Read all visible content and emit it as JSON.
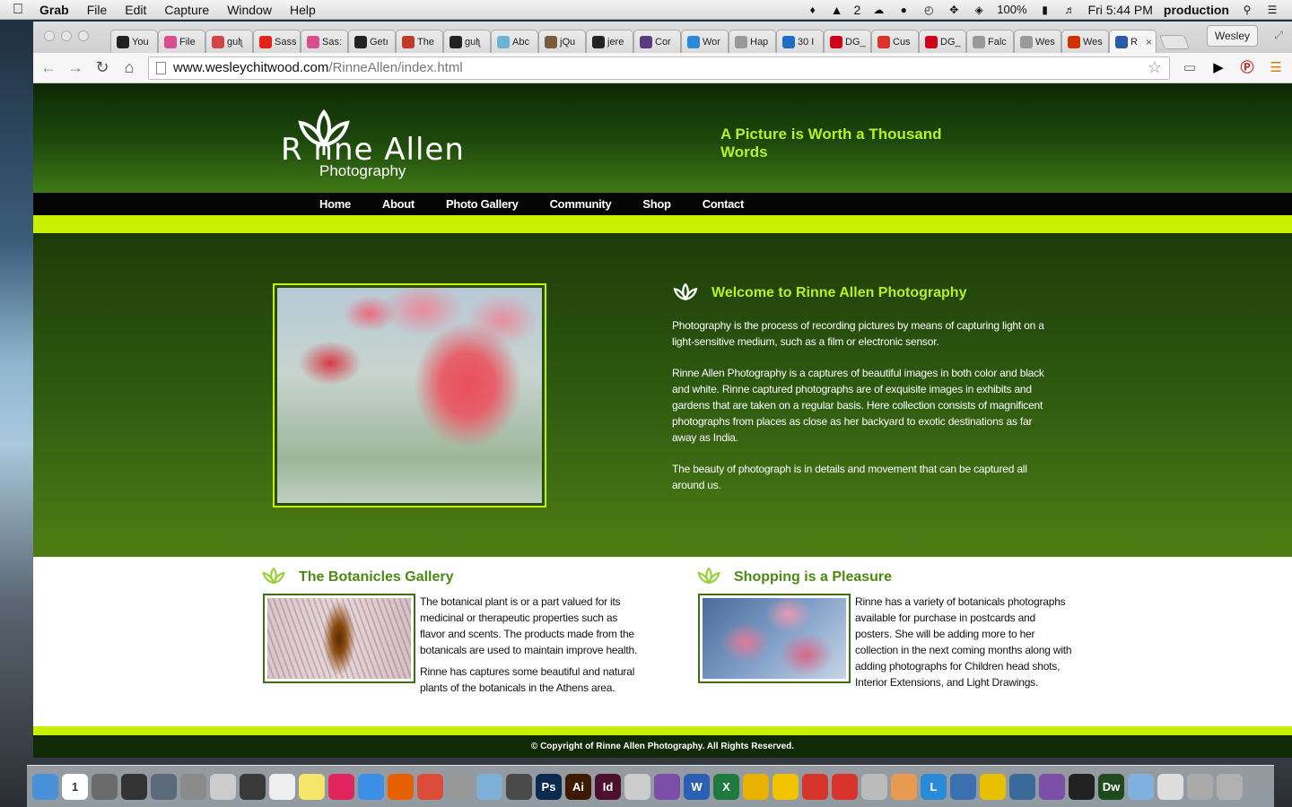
{
  "menubar": {
    "app": "Grab",
    "items": [
      "File",
      "Edit",
      "Capture",
      "Window",
      "Help"
    ],
    "status": {
      "notifications": "2",
      "battery": "100%",
      "clock": "Fri 5:44 PM",
      "user": "production"
    }
  },
  "browser": {
    "tabs": [
      {
        "label": "You",
        "color": "#222222",
        "icon": "github-icon"
      },
      {
        "label": "File",
        "color": "#d94f8c",
        "icon": "sass-icon"
      },
      {
        "label": "gulʅ",
        "color": "#cf4646",
        "icon": "gulp-icon"
      },
      {
        "label": "Sass",
        "color": "#e62117",
        "icon": "youtube-icon"
      },
      {
        "label": "Sas:",
        "color": "#d94f8c",
        "icon": "sass-icon"
      },
      {
        "label": "Getı",
        "color": "#222222",
        "icon": "circle-icon"
      },
      {
        "label": "The",
        "color": "#c0392b",
        "icon": "zo-icon"
      },
      {
        "label": "gulʅ",
        "color": "#222222",
        "icon": "github-icon"
      },
      {
        "label": "Abc",
        "color": "#6fb3d2",
        "icon": "code-icon"
      },
      {
        "label": "jQu",
        "color": "#7a5c3c",
        "icon": "avatar-icon"
      },
      {
        "label": "jere",
        "color": "#222222",
        "icon": "github-icon"
      },
      {
        "label": "Cor",
        "color": "#563d7c",
        "icon": "bootstrap-icon"
      },
      {
        "label": "Wor",
        "color": "#2b8ad8",
        "icon": "t-icon"
      },
      {
        "label": "Hap",
        "color": "#999999",
        "icon": "page-icon"
      },
      {
        "label": "30 I",
        "color": "#1e6fc2",
        "icon": "h-icon"
      },
      {
        "label": "DG_",
        "color": "#d0021b",
        "icon": "pr-icon"
      },
      {
        "label": "Cus",
        "color": "#d9342b",
        "icon": "s-icon"
      },
      {
        "label": "DG_",
        "color": "#d0021b",
        "icon": "pr-icon"
      },
      {
        "label": "Falc",
        "color": "#999999",
        "icon": "page-icon"
      },
      {
        "label": "Wes",
        "color": "#999999",
        "icon": "page-icon"
      },
      {
        "label": "Wes",
        "color": "#cc3300",
        "icon": "w-icon"
      },
      {
        "label": "R",
        "color": "#2b5ba8",
        "icon": "grid-icon"
      }
    ],
    "profile": "Wesley",
    "url_host": "www.wesleychitwood.com",
    "url_path": "/RinneAllen/index.html"
  },
  "site": {
    "logo": {
      "name": "R   nne Allen",
      "sub": "Photography"
    },
    "tagline": "A Picture is Worth a Thousand Words",
    "nav": [
      "Home",
      "About",
      "Photo Gallery",
      "Community",
      "Shop",
      "Contact"
    ],
    "welcome": {
      "title": "Welcome to Rinne Allen Photography",
      "p1": "Photography is the process of recording pictures by means of capturing light on a light-sensitive medium, such as a film or electronic sensor.",
      "p2": "Rinne Allen Photography is a captures of beautiful images in both color and black and white. Rinne captured photographs are of exquisite images in exhibits and gardens that are taken on a regular basis. Here collection consists of magnificent photographs from places as close as her backyard to exotic destinations as far away as India.",
      "p3": "The beauty of photograph is in details and movement that can be captured all around us."
    },
    "gallery": {
      "title": "The Botanicles Gallery",
      "p1": "The botanical plant is or a part valued for its medicinal or therapeutic properties such as flavor and scents. The products made from the botanicals are used to maintain improve health.",
      "p2": "Rinne has captures some beautiful and natural plants of the botanicals in the Athens area."
    },
    "shopping": {
      "title": "Shopping is a Pleasure",
      "p1": "Rinne has a variety of botanicals photographs available for purchase in postcards and posters. She will be adding more to her collection in the next coming months along with adding photographs for Children head shots, Interior Extensions, and Light Drawings."
    },
    "footer": "© Copyright of Rinne Allen Photography. All Rights Reserved.",
    "colors": {
      "accent": "#c8f000",
      "heading": "#b8f026",
      "dark_green": "#1e3d09"
    }
  },
  "dock": [
    {
      "name": "finder",
      "color": "#4a90d9"
    },
    {
      "name": "calendar",
      "color": "#ffffff",
      "text": "1"
    },
    {
      "name": "launchpad",
      "color": "#6b6b6b"
    },
    {
      "name": "dashboard",
      "color": "#333333"
    },
    {
      "name": "mission-control",
      "color": "#5a6a7a"
    },
    {
      "name": "system-preferences",
      "color": "#8a8a8a"
    },
    {
      "name": "calculator",
      "color": "#cccccc"
    },
    {
      "name": "facetime",
      "color": "#3a3a3a"
    },
    {
      "name": "textedit",
      "color": "#eeeeee"
    },
    {
      "name": "stickies",
      "color": "#f5e56b"
    },
    {
      "name": "itunes",
      "color": "#e0245e"
    },
    {
      "name": "safari",
      "color": "#3d8ee6"
    },
    {
      "name": "firefox",
      "color": "#e66000"
    },
    {
      "name": "chrome",
      "color": "#dd4b39"
    },
    {
      "name": "preview",
      "color": "#999999"
    },
    {
      "name": "photo-app",
      "color": "#7fb0d8"
    },
    {
      "name": "sublime",
      "color": "#4a4a4a"
    },
    {
      "name": "photoshop",
      "color": "#0a2b4f",
      "text": "Ps"
    },
    {
      "name": "illustrator",
      "color": "#3b1a00",
      "text": "Ai"
    },
    {
      "name": "indesign",
      "color": "#4c0f2e",
      "text": "Id"
    },
    {
      "name": "acrobat",
      "color": "#cccccc"
    },
    {
      "name": "music",
      "color": "#7b4ea8"
    },
    {
      "name": "word",
      "color": "#2b5fb4",
      "text": "W"
    },
    {
      "name": "excel",
      "color": "#1f7a3e",
      "text": "X"
    },
    {
      "name": "outlook",
      "color": "#e8b000"
    },
    {
      "name": "cyberduck",
      "color": "#f2c300"
    },
    {
      "name": "pdf",
      "color": "#d9342b"
    },
    {
      "name": "remote",
      "color": "#d9342b"
    },
    {
      "name": "pencil",
      "color": "#bbbbbb"
    },
    {
      "name": "balloon",
      "color": "#e89a50"
    },
    {
      "name": "l-app",
      "color": "#2b8ad8",
      "text": "L"
    },
    {
      "name": "clock",
      "color": "#3b6fb0"
    },
    {
      "name": "bbedit",
      "color": "#e8c000"
    },
    {
      "name": "network",
      "color": "#3a6a9a"
    },
    {
      "name": "github-app",
      "color": "#7b4ea8"
    },
    {
      "name": "terminal",
      "color": "#222222"
    },
    {
      "name": "dreamweaver",
      "color": "#1e4a1e",
      "text": "Dw"
    },
    {
      "name": "folder",
      "color": "#7fb0e0"
    },
    {
      "name": "documents",
      "color": "#dddddd"
    },
    {
      "name": "photos",
      "color": "#aaaaaa"
    },
    {
      "name": "trash",
      "color": "#b0b0b0"
    }
  ]
}
